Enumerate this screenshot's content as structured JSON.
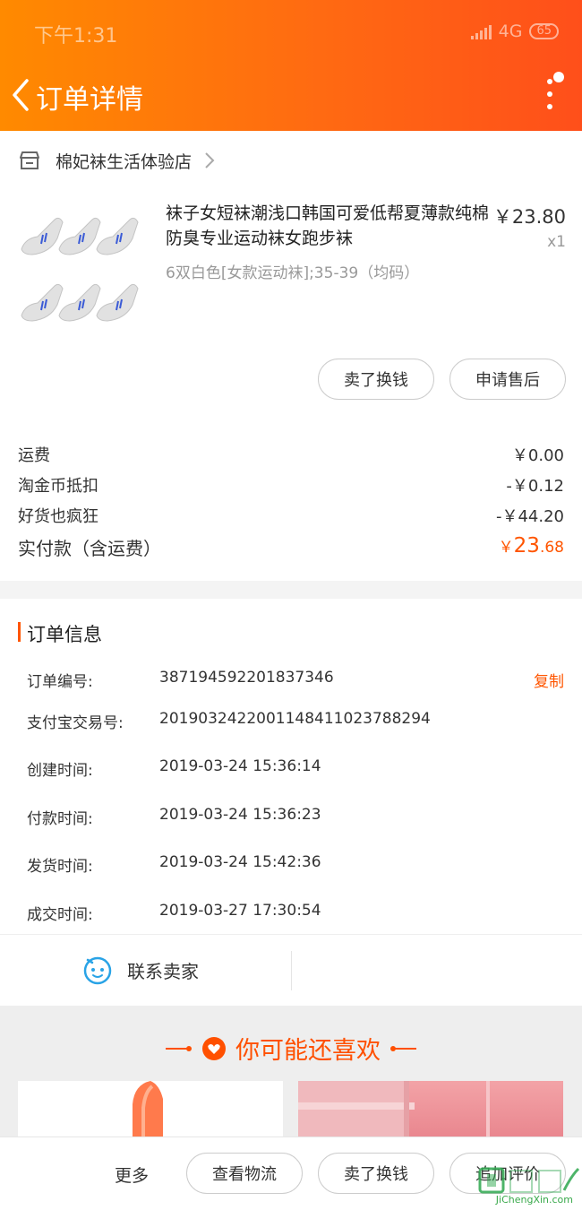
{
  "status_bar": {
    "time": "下午1:31",
    "network": "4G",
    "battery": "65"
  },
  "header": {
    "title": "订单详情"
  },
  "shop": {
    "name": "棉妃袜生活体验店"
  },
  "product": {
    "title": "袜子女短袜潮浅口韩国可爱低帮夏薄款纯棉防臭专业运动袜女跑步袜",
    "price": "￥23.80",
    "quantity": "x1",
    "sku": "6双白色[女款运动袜];35-39（均码）"
  },
  "item_actions": {
    "sell": "卖了换钱",
    "after_sale": "申请售后"
  },
  "fees": [
    {
      "label": "运费",
      "value": "￥0.00"
    },
    {
      "label": "淘金币抵扣",
      "value": "-￥0.12"
    },
    {
      "label": "好货也疯狂",
      "value": "-￥44.20"
    }
  ],
  "total": {
    "label": "实付款（含运费）",
    "currency": "￥",
    "major": "23",
    "minor": ".68"
  },
  "order_info": {
    "title": "订单信息",
    "copy_label": "复制",
    "rows": [
      {
        "label": "订单编号:",
        "value": "387194592201837346"
      },
      {
        "label": "支付宝交易号:",
        "value": "2019032422001148411023788294"
      },
      {
        "label": "创建时间:",
        "value": "2019-03-24 15:36:14"
      },
      {
        "label": "付款时间:",
        "value": "2019-03-24 15:36:23"
      },
      {
        "label": "发货时间:",
        "value": "2019-03-24 15:42:36"
      },
      {
        "label": "成交时间:",
        "value": "2019-03-27 17:30:54"
      }
    ]
  },
  "contact": {
    "label": "联系卖家"
  },
  "recommend": {
    "title": "你可能还喜欢"
  },
  "bottom_bar": {
    "more": "更多",
    "logistics": "查看物流",
    "sell": "卖了换钱",
    "review": "追加评价"
  },
  "watermark": {
    "text": "JiChengXin.com"
  },
  "colors": {
    "accent": "#ff5500",
    "header_start": "#ff8a00",
    "header_end": "#ff4f1a"
  }
}
